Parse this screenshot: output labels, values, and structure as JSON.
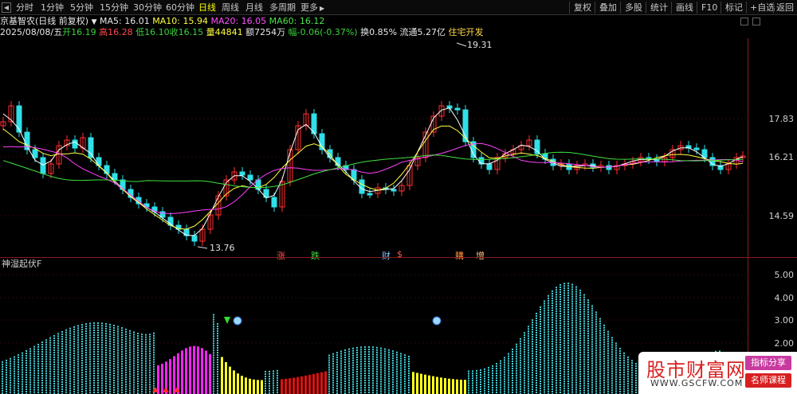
{
  "toolbar": {
    "arrow": "◀",
    "periods": [
      "分时",
      "1分钟",
      "5分钟",
      "15分钟",
      "30分钟",
      "60分钟",
      "日线",
      "周线",
      "月线",
      "多周期",
      "更多"
    ],
    "more_arrow": "▶",
    "active": "日线",
    "right_buttons": [
      "复权",
      "叠加",
      "多股",
      "统计",
      "画线",
      "F10",
      "标记",
      "+自选",
      "返回"
    ]
  },
  "info": {
    "stock_title": "京基智农(日线 前复权)",
    "ma_toggle": "▼",
    "ma5": "MA5: 16.01",
    "ma10": "MA10: 15.94",
    "ma20": "MA20: 16.05",
    "ma60": "MA60: 16.12",
    "date": "2025/08/08/五",
    "open_label": "开",
    "open_value": "16.19",
    "high_label": "高",
    "high_value": "16.28",
    "low_label": "低",
    "low_value": "16.10",
    "close_label": "收",
    "close_value": "16.15",
    "volume_label": "量",
    "volume_value": "44841",
    "amount_label": "额",
    "amount_value": "7254万",
    "change_label": "幅",
    "change_value": "-0.06(-0.37%)",
    "turnover_label": "换",
    "turnover_value": "0.85%",
    "float_label": "流通",
    "float_value": "5.27亿",
    "sector": "住宅开发"
  },
  "price_axis": {
    "labels": [
      "17.83",
      "16.21",
      "14.59"
    ],
    "high_annotation": "19.31",
    "low_annotation": "13.76"
  },
  "event_markers": [
    {
      "text": "涨",
      "color": "#ff5050"
    },
    {
      "text": "跌",
      "color": "#40dd40"
    },
    {
      "text": "财",
      "color": "#80c0ff"
    },
    {
      "text": "$",
      "color": "#ff5050"
    },
    {
      "text": "耩",
      "color": "#ff9040"
    },
    {
      "text": "增",
      "color": "#ffc080"
    }
  ],
  "indicator": {
    "title": "神湿起伏F",
    "axis_labels": [
      "5.00",
      "4.00",
      "3.00",
      "2.00"
    ]
  },
  "watermark": {
    "title": "股市财富网",
    "url": "WWW.GSCFW.COM",
    "tag1": "指标分享",
    "tag2": "名师课程"
  },
  "colors": {
    "up": "#ff3030",
    "down": "#30e0e8",
    "ma5": "#ffffff",
    "ma10": "#ffff40",
    "ma20": "#ff40ff",
    "ma60": "#40e040",
    "bar_cyan": "#40d0d8",
    "bar_yellow": "#ffff20",
    "bar_red": "#e01010",
    "bar_magenta": "#ff20ff",
    "watermark_red": "#d82020",
    "tag1_bg": "#c83aa0",
    "tag2_bg": "#d82020"
  }
}
